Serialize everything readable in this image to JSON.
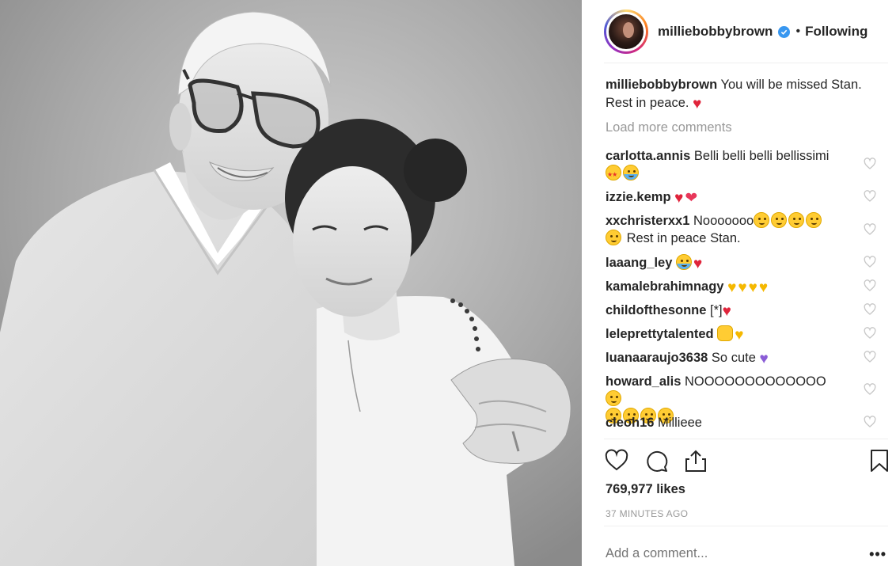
{
  "post": {
    "photo_alt": "Black and white photo of an elderly man with tinted glasses hugging a young girl with hair buns",
    "account": {
      "username": "milliebobbybrown",
      "verified": true,
      "separator": "•",
      "follow_status": "Following"
    },
    "caption": {
      "username": "milliebobbybrown",
      "text": "You will be missed Stan. Rest in peace."
    },
    "load_more_label": "Load more comments",
    "comments": [
      {
        "username": "carlotta.annis",
        "text": "Belli belli belli bellissimi"
      },
      {
        "username": "izzie.kemp",
        "text": ""
      },
      {
        "username": "xxchristerxx1",
        "text": "Nooooooo"
      },
      {
        "username": "laaang_ley",
        "text": ""
      },
      {
        "username": "kamalebrahimnagy",
        "text": ""
      },
      {
        "username": "childofthesonne",
        "text": "[*]"
      },
      {
        "username": "leleprettytalented",
        "text": ""
      },
      {
        "username": "luanaaraujo3638",
        "text": "So cute"
      },
      {
        "username": "howard_alis",
        "text": "NOOOOOOOOOOOOO"
      },
      {
        "username": "cleoh16",
        "text": "Millieee"
      }
    ],
    "comment_extra": {
      "xxchristerxx1_tail": "Rest in peace Stan."
    },
    "likes_label": "769,977 likes",
    "timestamp": "37 MINUTES AGO",
    "add_comment_placeholder": "Add a comment...",
    "more_options": "•••"
  },
  "colors": {
    "link_text": "#262626",
    "muted_text": "#999999",
    "verified_badge": "#3897f0",
    "divider": "#efefef"
  },
  "icons": [
    "heart-icon",
    "comment-icon",
    "share-icon",
    "bookmark-icon",
    "verified-icon",
    "more-icon"
  ]
}
